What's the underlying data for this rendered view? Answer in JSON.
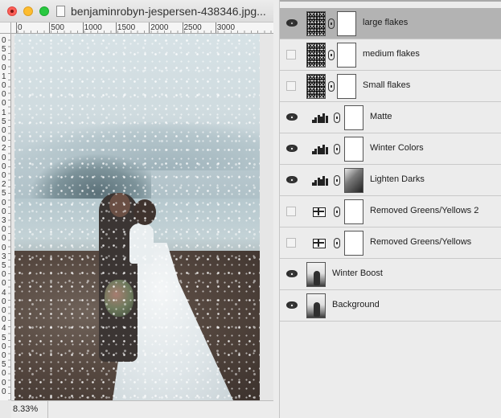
{
  "document": {
    "title": "benjaminrobyn-jespersen-438346.jpg...",
    "zoom": "8.33%",
    "ruler_top_labels": [
      "0",
      "500",
      "1000",
      "1500",
      "2000",
      "2500",
      "3000"
    ],
    "ruler_left_digits": [
      "0",
      "5",
      "0",
      "0",
      "1",
      "0",
      "0",
      "0",
      "1",
      "5",
      "0",
      "0",
      "2",
      "0",
      "0",
      "0",
      "2",
      "5",
      "0",
      "0",
      "3",
      "0",
      "0",
      "0",
      "3",
      "5",
      "0",
      "0",
      "4",
      "0",
      "0",
      "0",
      "4",
      "5",
      "0",
      "0",
      "5",
      "0",
      "0",
      "0"
    ]
  },
  "layers": [
    {
      "name": "large flakes",
      "visible": true,
      "selected": true,
      "thumb": "flakes",
      "mask": true,
      "link": true,
      "adj": ""
    },
    {
      "name": "medium flakes",
      "visible": false,
      "selected": false,
      "thumb": "flakes",
      "mask": true,
      "link": true,
      "adj": ""
    },
    {
      "name": "Small flakes",
      "visible": false,
      "selected": false,
      "thumb": "flakes",
      "mask": true,
      "link": true,
      "adj": ""
    },
    {
      "name": "Matte",
      "visible": true,
      "selected": false,
      "thumb": "",
      "mask": true,
      "link": true,
      "adj": "curves"
    },
    {
      "name": "Winter Colors",
      "visible": true,
      "selected": false,
      "thumb": "",
      "mask": true,
      "link": true,
      "adj": "curves"
    },
    {
      "name": "Lighten Darks",
      "visible": true,
      "selected": false,
      "thumb": "",
      "mask": "dark",
      "link": true,
      "adj": "curves"
    },
    {
      "name": "Removed Greens/Yellows 2",
      "visible": false,
      "selected": false,
      "thumb": "",
      "mask": true,
      "link": true,
      "adj": "levels"
    },
    {
      "name": "Removed Greens/Yellows",
      "visible": false,
      "selected": false,
      "thumb": "",
      "mask": true,
      "link": true,
      "adj": "levels"
    },
    {
      "name": "Winter Boost",
      "visible": true,
      "selected": false,
      "thumb": "photo",
      "mask": false,
      "link": false,
      "adj": ""
    },
    {
      "name": "Background",
      "visible": true,
      "selected": false,
      "thumb": "photo",
      "mask": false,
      "link": false,
      "adj": ""
    }
  ],
  "icons": {
    "eye": "eye-icon",
    "link": "chain-link-icon",
    "curves": "curves-adjustment-icon",
    "levels": "levels-adjustment-icon"
  }
}
